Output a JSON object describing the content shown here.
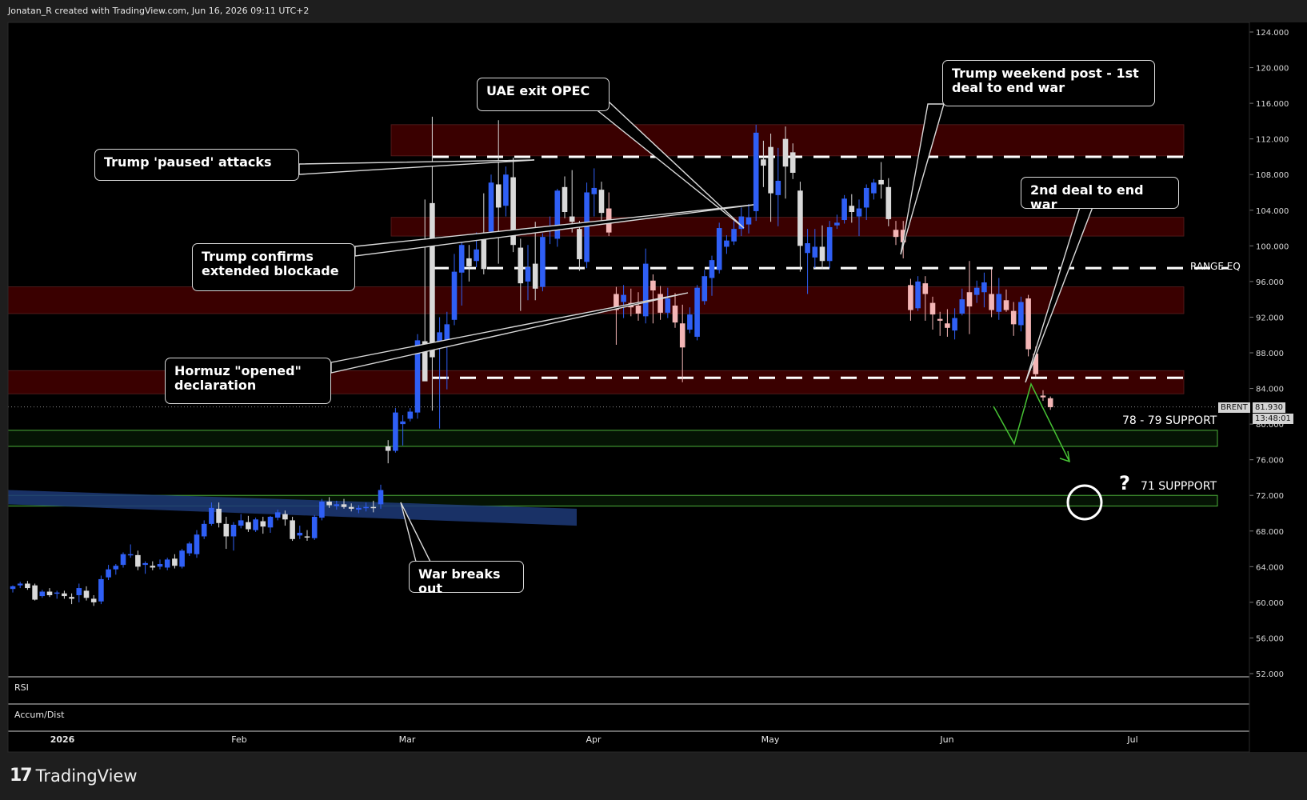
{
  "credit": "Jonatan_R created with TradingView.com, Jun 16, 2026 09:11 UTC+2",
  "brand": "TradingView",
  "colors": {
    "background": "#000000",
    "frame": "#1e1e1e",
    "bull": "#2f5ff5",
    "bear": "#d9d9d9",
    "bear_pink": "#f4b6b6",
    "zone_red": "#3a0000",
    "zone_green": "#0c2a08",
    "trend_blue": "#1d3a78"
  },
  "panels": {
    "rsi_label": "RSI",
    "accum_label": "Accum/Dist"
  },
  "price_tag": {
    "symbol": "BRENT",
    "price": "81.930",
    "countdown": "13:48:01"
  },
  "annotations": {
    "paused": "Trump 'paused' attacks",
    "uae": "UAE exit OPEC",
    "weekend": "Trump weekend post - 1st\ndeal to end war",
    "blockade": "Trump confirms\nextended blockade",
    "hormuz": "Hormuz \"opened\"\ndeclaration",
    "deal2": "2nd deal to end war",
    "war": "War breaks out",
    "range_eq": "RANGE EQ",
    "support78": "78 - 79 SUPPORT",
    "support71": "71 SUPPPORT",
    "question": "?"
  },
  "chart_data": {
    "type": "candlestick",
    "symbol": "BRENT",
    "x_axis": {
      "labels": [
        "2026",
        "Feb",
        "Mar",
        "Apr",
        "May",
        "Jun",
        "Jul"
      ],
      "range": [
        "2026-01-01",
        "2026-07-31"
      ]
    },
    "y_axis": {
      "ticks": [
        "124.000",
        "120.000",
        "116.000",
        "112.000",
        "108.000",
        "104.000",
        "100.000",
        "96.000",
        "92.000",
        "88.000",
        "84.000",
        "80.000",
        "76.000",
        "72.000",
        "68.000",
        "64.000",
        "60.000",
        "56.000",
        "52.000"
      ],
      "ylim": [
        52,
        125
      ]
    },
    "last_price": 81.93,
    "zones": [
      {
        "type": "resistance",
        "from": 110.1,
        "to": 113.6
      },
      {
        "type": "resistance",
        "from": 101.1,
        "to": 103.2
      },
      {
        "type": "resistance",
        "from": 92.4,
        "to": 95.4
      },
      {
        "type": "resistance",
        "from": 83.4,
        "to": 86.0
      },
      {
        "type": "support",
        "from": 77.5,
        "to": 79.3,
        "label": "78 - 79 SUPPORT"
      },
      {
        "type": "support",
        "from": 70.8,
        "to": 72.0,
        "label": "71 SUPPPORT"
      }
    ],
    "dashed_levels": [
      110.0,
      97.5,
      85.2
    ],
    "range_eq_level": 97.5,
    "candles": [
      {
        "o": 61.5,
        "h": 61.9,
        "l": 61.1,
        "c": 61.8
      },
      {
        "o": 61.9,
        "h": 62.3,
        "l": 61.6,
        "c": 62.1
      },
      {
        "o": 62.1,
        "h": 62.4,
        "l": 61.4,
        "c": 61.6
      },
      {
        "o": 61.9,
        "h": 62.1,
        "l": 60.2,
        "c": 60.3
      },
      {
        "o": 60.7,
        "h": 61.4,
        "l": 60.5,
        "c": 61.2
      },
      {
        "o": 61.2,
        "h": 61.6,
        "l": 60.6,
        "c": 60.8
      },
      {
        "o": 61.0,
        "h": 61.3,
        "l": 60.4,
        "c": 61.1
      },
      {
        "o": 61.0,
        "h": 61.3,
        "l": 60.4,
        "c": 60.7
      },
      {
        "o": 60.6,
        "h": 61.0,
        "l": 59.8,
        "c": 60.4
      },
      {
        "o": 60.8,
        "h": 62.1,
        "l": 60.0,
        "c": 61.6
      },
      {
        "o": 61.3,
        "h": 61.8,
        "l": 60.2,
        "c": 60.5
      },
      {
        "o": 60.4,
        "h": 60.8,
        "l": 59.6,
        "c": 60.0
      },
      {
        "o": 60.1,
        "h": 63.0,
        "l": 59.8,
        "c": 62.6
      },
      {
        "o": 62.8,
        "h": 64.2,
        "l": 62.5,
        "c": 63.7
      },
      {
        "o": 63.7,
        "h": 64.3,
        "l": 63.1,
        "c": 64.1
      },
      {
        "o": 64.2,
        "h": 65.6,
        "l": 63.9,
        "c": 65.4
      },
      {
        "o": 65.3,
        "h": 66.5,
        "l": 65.0,
        "c": 65.4
      },
      {
        "o": 65.3,
        "h": 65.8,
        "l": 63.6,
        "c": 64.0
      },
      {
        "o": 64.2,
        "h": 64.6,
        "l": 63.2,
        "c": 64.4
      },
      {
        "o": 64.1,
        "h": 64.6,
        "l": 63.6,
        "c": 63.9
      },
      {
        "o": 64.0,
        "h": 64.8,
        "l": 63.7,
        "c": 64.3
      },
      {
        "o": 63.9,
        "h": 65.0,
        "l": 63.6,
        "c": 64.8
      },
      {
        "o": 64.9,
        "h": 65.4,
        "l": 63.8,
        "c": 64.1
      },
      {
        "o": 64.0,
        "h": 66.0,
        "l": 63.8,
        "c": 65.8
      },
      {
        "o": 65.5,
        "h": 66.8,
        "l": 65.2,
        "c": 66.6
      },
      {
        "o": 65.4,
        "h": 68.1,
        "l": 65.0,
        "c": 67.6
      },
      {
        "o": 67.4,
        "h": 69.2,
        "l": 67.1,
        "c": 68.8
      },
      {
        "o": 68.8,
        "h": 71.2,
        "l": 68.6,
        "c": 70.6
      },
      {
        "o": 70.5,
        "h": 71.2,
        "l": 68.4,
        "c": 68.9
      },
      {
        "o": 68.8,
        "h": 69.6,
        "l": 66.0,
        "c": 67.4
      },
      {
        "o": 67.4,
        "h": 69.0,
        "l": 65.8,
        "c": 68.7
      },
      {
        "o": 68.6,
        "h": 69.9,
        "l": 68.3,
        "c": 69.2
      },
      {
        "o": 69.0,
        "h": 69.7,
        "l": 67.9,
        "c": 68.2
      },
      {
        "o": 68.1,
        "h": 69.5,
        "l": 67.9,
        "c": 69.3
      },
      {
        "o": 69.1,
        "h": 69.6,
        "l": 67.7,
        "c": 68.5
      },
      {
        "o": 68.4,
        "h": 69.7,
        "l": 67.8,
        "c": 69.6
      },
      {
        "o": 69.5,
        "h": 70.4,
        "l": 69.2,
        "c": 70.1
      },
      {
        "o": 69.9,
        "h": 70.3,
        "l": 68.6,
        "c": 69.3
      },
      {
        "o": 69.2,
        "h": 69.6,
        "l": 66.9,
        "c": 67.1
      },
      {
        "o": 67.5,
        "h": 68.6,
        "l": 67.1,
        "c": 67.8
      },
      {
        "o": 67.4,
        "h": 68.1,
        "l": 66.9,
        "c": 67.3
      },
      {
        "o": 67.2,
        "h": 69.8,
        "l": 67.0,
        "c": 69.6
      },
      {
        "o": 69.5,
        "h": 71.6,
        "l": 69.2,
        "c": 71.3
      },
      {
        "o": 71.3,
        "h": 71.8,
        "l": 70.6,
        "c": 70.9
      },
      {
        "o": 70.8,
        "h": 71.4,
        "l": 70.4,
        "c": 71.0
      },
      {
        "o": 71.0,
        "h": 71.6,
        "l": 70.5,
        "c": 70.7
      },
      {
        "o": 70.7,
        "h": 71.1,
        "l": 70.2,
        "c": 70.5
      },
      {
        "o": 70.4,
        "h": 70.9,
        "l": 70.0,
        "c": 70.6
      },
      {
        "o": 70.6,
        "h": 71.2,
        "l": 70.2,
        "c": 70.7
      },
      {
        "o": 70.7,
        "h": 71.4,
        "l": 70.1,
        "c": 70.6
      },
      {
        "o": 71.0,
        "h": 73.2,
        "l": 70.5,
        "c": 72.6
      },
      {
        "o": 77.5,
        "h": 78.2,
        "l": 75.6,
        "c": 77.0
      },
      {
        "o": 77.0,
        "h": 81.8,
        "l": 76.8,
        "c": 81.3
      },
      {
        "o": 80.0,
        "h": 81.0,
        "l": 77.6,
        "c": 80.3
      },
      {
        "o": 80.6,
        "h": 81.8,
        "l": 80.3,
        "c": 81.4
      },
      {
        "o": 81.3,
        "h": 90.1,
        "l": 80.6,
        "c": 89.4
      },
      {
        "o": 89.3,
        "h": 105.2,
        "l": 86.3,
        "c": 84.8
      },
      {
        "o": 104.8,
        "h": 114.5,
        "l": 81.5,
        "c": 87.5
      },
      {
        "o": 89.0,
        "h": 92.0,
        "l": 79.5,
        "c": 90.3
      },
      {
        "o": 89.3,
        "h": 92.6,
        "l": 83.9,
        "c": 91.2
      },
      {
        "o": 91.7,
        "h": 99.1,
        "l": 91.1,
        "c": 97.1
      },
      {
        "o": 97.0,
        "h": 100.6,
        "l": 93.3,
        "c": 100.1
      },
      {
        "o": 98.6,
        "h": 100.1,
        "l": 96.0,
        "c": 97.7
      },
      {
        "o": 98.3,
        "h": 101.5,
        "l": 97.6,
        "c": 99.6
      },
      {
        "o": 100.7,
        "h": 105.9,
        "l": 96.8,
        "c": 97.4
      },
      {
        "o": 101.6,
        "h": 108.0,
        "l": 100.9,
        "c": 107.1
      },
      {
        "o": 106.9,
        "h": 114.1,
        "l": 98.0,
        "c": 104.3
      },
      {
        "o": 104.5,
        "h": 108.9,
        "l": 103.3,
        "c": 108.0
      },
      {
        "o": 107.7,
        "h": 109.9,
        "l": 99.3,
        "c": 100.1
      },
      {
        "o": 99.8,
        "h": 100.8,
        "l": 92.7,
        "c": 95.8
      },
      {
        "o": 96.0,
        "h": 100.1,
        "l": 93.9,
        "c": 97.6
      },
      {
        "o": 98.0,
        "h": 102.7,
        "l": 93.9,
        "c": 95.2
      },
      {
        "o": 95.4,
        "h": 101.4,
        "l": 94.9,
        "c": 101.0
      },
      {
        "o": 101.7,
        "h": 103.3,
        "l": 100.2,
        "c": 101.9
      },
      {
        "o": 100.8,
        "h": 106.4,
        "l": 99.9,
        "c": 106.2
      },
      {
        "o": 106.6,
        "h": 107.8,
        "l": 103.1,
        "c": 103.8
      },
      {
        "o": 103.3,
        "h": 108.5,
        "l": 101.5,
        "c": 102.7
      },
      {
        "o": 101.9,
        "h": 102.8,
        "l": 97.2,
        "c": 98.5
      },
      {
        "o": 98.2,
        "h": 107.1,
        "l": 97.5,
        "c": 106.0
      },
      {
        "o": 105.8,
        "h": 108.7,
        "l": 103.3,
        "c": 106.5
      },
      {
        "o": 106.3,
        "h": 107.2,
        "l": 102.8,
        "c": 103.7
      },
      {
        "o": 104.2,
        "h": 106.0,
        "l": 101.1,
        "c": 101.5
      },
      {
        "o": 94.6,
        "h": 95.4,
        "l": 88.9,
        "c": 92.8
      },
      {
        "o": 93.7,
        "h": 95.6,
        "l": 91.9,
        "c": 94.5
      },
      {
        "o": 93.6,
        "h": 95.2,
        "l": 92.1,
        "c": 93.1
      },
      {
        "o": 93.3,
        "h": 94.8,
        "l": 91.6,
        "c": 92.4
      },
      {
        "o": 92.1,
        "h": 99.7,
        "l": 91.3,
        "c": 98.0
      },
      {
        "o": 96.1,
        "h": 96.8,
        "l": 91.3,
        "c": 95.0
      },
      {
        "o": 94.6,
        "h": 95.5,
        "l": 91.7,
        "c": 92.5
      },
      {
        "o": 92.5,
        "h": 95.3,
        "l": 91.9,
        "c": 94.1
      },
      {
        "o": 93.3,
        "h": 94.7,
        "l": 90.8,
        "c": 91.4
      },
      {
        "o": 91.3,
        "h": 93.4,
        "l": 84.7,
        "c": 88.6
      },
      {
        "o": 90.6,
        "h": 93.1,
        "l": 90.2,
        "c": 92.3
      },
      {
        "o": 89.8,
        "h": 95.6,
        "l": 89.4,
        "c": 95.3
      },
      {
        "o": 93.8,
        "h": 97.3,
        "l": 93.4,
        "c": 96.6
      },
      {
        "o": 96.4,
        "h": 98.9,
        "l": 94.4,
        "c": 98.4
      },
      {
        "o": 97.3,
        "h": 102.6,
        "l": 96.9,
        "c": 102.0
      },
      {
        "o": 99.9,
        "h": 101.2,
        "l": 99.1,
        "c": 100.6
      },
      {
        "o": 100.5,
        "h": 102.8,
        "l": 100.1,
        "c": 101.9
      },
      {
        "o": 101.9,
        "h": 104.3,
        "l": 101.1,
        "c": 103.3
      },
      {
        "o": 102.4,
        "h": 104.7,
        "l": 101.4,
        "c": 103.2
      },
      {
        "o": 103.9,
        "h": 113.6,
        "l": 102.8,
        "c": 112.7
      },
      {
        "o": 109.7,
        "h": 111.8,
        "l": 106.6,
        "c": 109.0
      },
      {
        "o": 111.1,
        "h": 112.6,
        "l": 102.7,
        "c": 105.9
      },
      {
        "o": 105.7,
        "h": 111.0,
        "l": 102.2,
        "c": 107.3
      },
      {
        "o": 112.0,
        "h": 113.4,
        "l": 105.3,
        "c": 108.9
      },
      {
        "o": 110.5,
        "h": 111.5,
        "l": 107.5,
        "c": 108.2
      },
      {
        "o": 106.2,
        "h": 107.2,
        "l": 97.1,
        "c": 100.0
      },
      {
        "o": 99.2,
        "h": 101.9,
        "l": 94.6,
        "c": 100.3
      },
      {
        "o": 98.7,
        "h": 101.9,
        "l": 97.5,
        "c": 99.9
      },
      {
        "o": 99.9,
        "h": 102.3,
        "l": 97.4,
        "c": 98.3
      },
      {
        "o": 98.3,
        "h": 102.8,
        "l": 97.5,
        "c": 102.1
      },
      {
        "o": 102.3,
        "h": 103.5,
        "l": 101.9,
        "c": 102.6
      },
      {
        "o": 102.9,
        "h": 105.7,
        "l": 102.5,
        "c": 105.3
      },
      {
        "o": 104.5,
        "h": 105.8,
        "l": 102.6,
        "c": 103.8
      },
      {
        "o": 103.3,
        "h": 105.2,
        "l": 101.1,
        "c": 104.2
      },
      {
        "o": 104.3,
        "h": 106.9,
        "l": 102.9,
        "c": 106.5
      },
      {
        "o": 105.9,
        "h": 107.5,
        "l": 105.2,
        "c": 107.1
      },
      {
        "o": 107.4,
        "h": 109.4,
        "l": 105.3,
        "c": 106.9
      },
      {
        "o": 106.6,
        "h": 107.6,
        "l": 102.2,
        "c": 103.0
      },
      {
        "o": 101.8,
        "h": 102.8,
        "l": 100.1,
        "c": 101.0
      },
      {
        "o": 101.8,
        "h": 102.8,
        "l": 98.6,
        "c": 100.4
      },
      {
        "o": 95.6,
        "h": 96.3,
        "l": 91.6,
        "c": 92.8
      },
      {
        "o": 93.0,
        "h": 96.6,
        "l": 92.7,
        "c": 96.0
      },
      {
        "o": 95.8,
        "h": 96.6,
        "l": 91.6,
        "c": 94.6
      },
      {
        "o": 93.6,
        "h": 94.3,
        "l": 90.6,
        "c": 92.3
      },
      {
        "o": 91.8,
        "h": 92.6,
        "l": 89.9,
        "c": 91.6
      },
      {
        "o": 91.3,
        "h": 92.9,
        "l": 89.8,
        "c": 90.8
      },
      {
        "o": 90.5,
        "h": 93.0,
        "l": 89.5,
        "c": 91.9
      },
      {
        "o": 92.4,
        "h": 95.2,
        "l": 92.2,
        "c": 94.0
      },
      {
        "o": 94.8,
        "h": 98.3,
        "l": 90.1,
        "c": 93.2
      },
      {
        "o": 94.5,
        "h": 96.1,
        "l": 93.6,
        "c": 95.3
      },
      {
        "o": 94.8,
        "h": 97.0,
        "l": 93.1,
        "c": 95.9
      },
      {
        "o": 94.6,
        "h": 97.4,
        "l": 92.0,
        "c": 92.8
      },
      {
        "o": 92.6,
        "h": 96.4,
        "l": 91.7,
        "c": 94.6
      },
      {
        "o": 93.9,
        "h": 95.1,
        "l": 92.6,
        "c": 92.8
      },
      {
        "o": 92.7,
        "h": 93.7,
        "l": 89.9,
        "c": 91.2
      },
      {
        "o": 91.1,
        "h": 94.3,
        "l": 90.4,
        "c": 93.7
      },
      {
        "o": 94.1,
        "h": 94.5,
        "l": 87.6,
        "c": 88.4
      },
      {
        "o": 87.9,
        "h": 88.7,
        "l": 85.3,
        "c": 85.6
      },
      {
        "o": 83.2,
        "h": 83.8,
        "l": 82.6,
        "c": 83.0
      },
      {
        "o": 82.9,
        "h": 83.1,
        "l": 81.6,
        "c": 81.9
      }
    ],
    "projection_path": [
      [
        1242,
        82.0
      ],
      [
        1268,
        77.8
      ],
      [
        1289,
        84.5
      ],
      [
        1337,
        75.8
      ]
    ]
  }
}
